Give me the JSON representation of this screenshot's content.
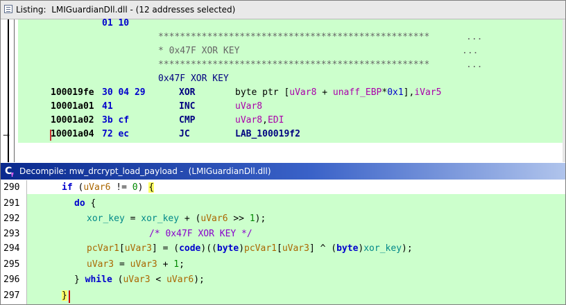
{
  "listing": {
    "title": "Listing:  LMIGuardianDll.dll - (12 addresses selected)",
    "rows": [
      {
        "bytes": "01 10"
      },
      {
        "stars": "**************************************************",
        "dots": "..."
      },
      {
        "comment": "* 0x47F XOR KEY",
        "dots": "..."
      },
      {
        "stars": "**************************************************",
        "dots": "..."
      },
      {
        "label": "0x47F XOR KEY"
      },
      {
        "addr": "100019fe",
        "bytes": "30 04 29",
        "mnem": "XOR",
        "op1": "byte ptr [",
        "op2": "uVar8",
        "op3": " + ",
        "op4": "unaff_EBP",
        "op5": "*",
        "op6": "0x1",
        "op7": "],",
        "op8": "iVar5"
      },
      {
        "addr": "10001a01",
        "bytes": "41",
        "mnem": "INC",
        "op1": "uVar8"
      },
      {
        "addr": "10001a02",
        "bytes": "3b cf",
        "mnem": "CMP",
        "op1": "uVar8",
        "op2": ",",
        "op3": "EDI"
      },
      {
        "addr": "10001a04",
        "bytes": "72 ec",
        "mnem": "JC",
        "op1": "LAB_100019f2"
      }
    ]
  },
  "decompile": {
    "title": "Decompile: mw_drcrypt_load_payload -  (LMIGuardianDll.dll)",
    "line_numbers": [
      "290",
      "291",
      "292",
      "293",
      "294",
      "295",
      "296",
      "297"
    ],
    "l290": {
      "kw": "if",
      "p1": " (",
      "v1": "uVar6",
      "p2": " != ",
      "n1": "0",
      "p3": ") ",
      "b": "{"
    },
    "l291": {
      "kw": "do",
      "p1": " {"
    },
    "l292": {
      "g1": "xor_key",
      "p1": " = ",
      "g2": "xor_key",
      "p2": " + (",
      "v1": "uVar6",
      "p3": " >> ",
      "n1": "1",
      "p4": ");"
    },
    "l293": {
      "c": "/* 0x47F XOR KEY */"
    },
    "l294": {
      "v1": "pcVar1",
      "p1": "[",
      "v2": "uVar3",
      "p2": "] = (",
      "k1": "code",
      "p3": ")((",
      "k2": "byte",
      "p4": ")",
      "v3": "pcVar1",
      "p5": "[",
      "v4": "uVar3",
      "p6": "] ^ (",
      "k3": "byte",
      "p7": ")",
      "g1": "xor_key",
      "p8": ");"
    },
    "l295": {
      "v1": "uVar3",
      "p1": " = ",
      "v2": "uVar3",
      "p2": " + ",
      "n1": "1",
      "p3": ";"
    },
    "l296": {
      "p1": "} ",
      "kw": "while",
      "p2": " (",
      "v1": "uVar3",
      "p3": " < ",
      "v2": "uVar6",
      "p4": ");"
    },
    "l297": {
      "b": "}"
    }
  }
}
